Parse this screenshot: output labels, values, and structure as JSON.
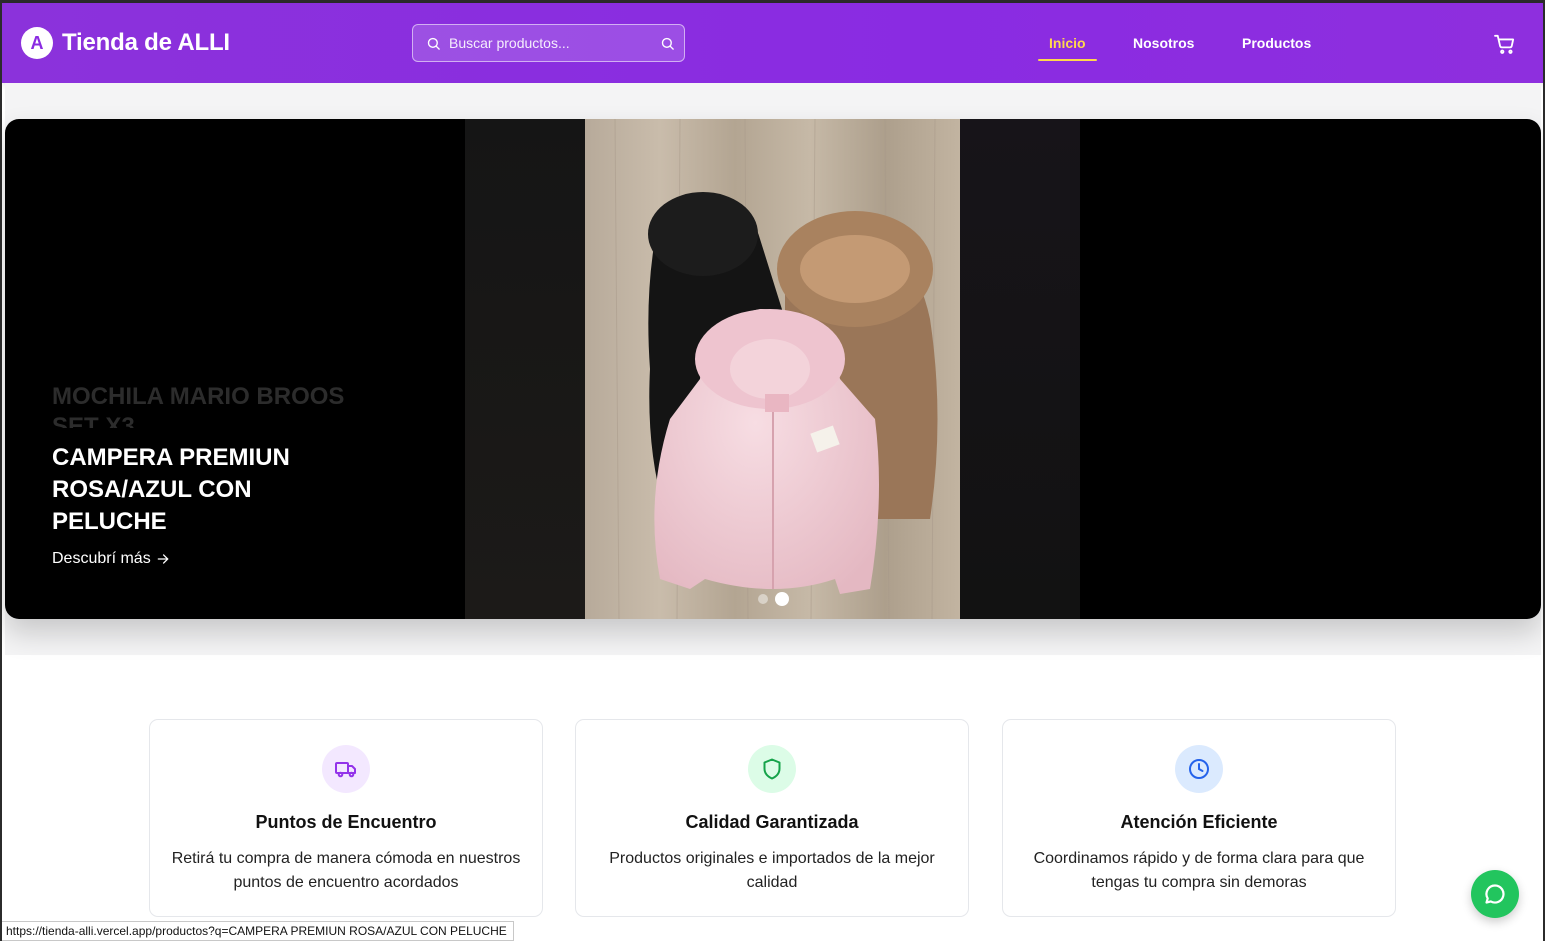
{
  "header": {
    "logo_letter": "A",
    "title": "Tienda de ALLI",
    "search_placeholder": "Buscar productos...",
    "nav": [
      {
        "label": "Inicio",
        "active": true
      },
      {
        "label": "Nosotros",
        "active": false
      },
      {
        "label": "Productos",
        "active": false
      }
    ],
    "cart_icon": "shopping-cart-icon"
  },
  "hero": {
    "previous_title": "MOCHILA MARIO BROOS SET X3",
    "title": "CAMPERA PREMIUN ROSA/AZUL CON PELUCHE",
    "cta": "Descubrí más",
    "cta_icon": "arrow-right-icon",
    "slides_total": 2,
    "active_slide": 2
  },
  "features": [
    {
      "icon": "truck-icon",
      "title": "Puntos de Encuentro",
      "desc": "Retirá tu compra de manera cómoda en nuestros puntos de encuentro acordados",
      "bg": "#f3e8ff",
      "color": "#9333ea"
    },
    {
      "icon": "shield-icon",
      "title": "Calidad Garantizada",
      "desc": "Productos originales e importados de la mejor calidad",
      "bg": "#dcfce7",
      "color": "#16a34a"
    },
    {
      "icon": "clock-icon",
      "title": "Atención Eficiente",
      "desc": "Coordinamos rápido y de forma clara para que tengas tu compra sin demoras",
      "bg": "#dbeafe",
      "color": "#2563eb"
    }
  ],
  "chat": {
    "icon": "chat-bubble-icon",
    "color": "#22c55e"
  },
  "status_bar": {
    "url": "https://tienda-alli.vercel.app/productos?q=CAMPERA  PREMIUN ROSA/AZUL CON PELUCHE"
  },
  "colors": {
    "header": "#8a2be2",
    "active_nav": "#ffd84d"
  }
}
